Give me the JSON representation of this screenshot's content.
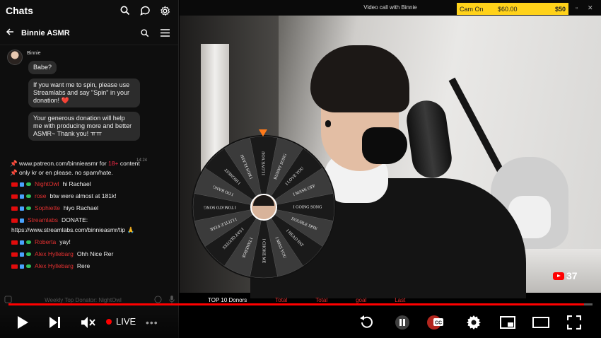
{
  "chats": {
    "title": "Chats",
    "icons": [
      "search-icon",
      "new-chat-icon",
      "settings-icon"
    ]
  },
  "conversation": {
    "name": "Binnie ASMR",
    "sender": "Binnie",
    "messages": [
      "Babe?",
      "If you want me to spin, please use Streamlabs and say \"Spin\" in your donation! ❤️",
      "Your generous donation will help me with producing more and better ASMR~ Thank you! ㅠㅠ"
    ],
    "timestamp": "14:24"
  },
  "live_chat": {
    "pinned_prefix": "📌 www.patreon.com/binnieasmr for ",
    "pinned_highlight": "18+",
    "pinned_suffix": " content",
    "pinned_line2": "📌 only kr or en please. no spam/hate.",
    "lines": [
      {
        "user": "NightOwl",
        "text": "hi Rachael"
      },
      {
        "user": "rose",
        "text": "btw were almost at 181k!"
      },
      {
        "user": "Sophiette",
        "text": "hiyo Rachael"
      },
      {
        "user": "Streamlabs",
        "text": "DONATE:"
      }
    ],
    "url_line": "https://www.streamlabs.com/binnieasmr/tip 🙏",
    "lines2": [
      {
        "user": "Roberta",
        "text": "yay!"
      },
      {
        "user": "Alex Hyllebarg",
        "text": "Ohh Nice Rer"
      },
      {
        "user": "Alex Hyllebarg",
        "text": "Rere"
      }
    ],
    "input_placeholder": "Weekly Top Donator: NightOwl"
  },
  "video": {
    "call_title": "Video call with Binnie",
    "cam_label": "Cam On",
    "cam_price": "$60.00",
    "cam_tip": "$50",
    "viewer_count": "37",
    "ticker": [
      "TOP 10 Donors",
      "Total",
      "Total",
      "goal",
      "Last"
    ],
    "wheel": {
      "segments": [
        "I LOVE YOU",
        "BUNNY SONG",
        "I LOVE YOU",
        "I MASK OFF",
        "I GOING SONG",
        "DOUBLE SPIN",
        "I HEAD PAT",
        "I MISS YOU",
        "I CHOKE ME",
        "I TAKEBOE",
        "I SAY QUOTES",
        "I LITTLE STAR",
        "I TOMATO SONG",
        "I DO BANG",
        "I HIGHEST",
        "I RUN FLASH"
      ],
      "colors": [
        "#1a1a1a",
        "#3b3b3b"
      ]
    }
  },
  "player": {
    "live_label": "LIVE",
    "progress_fraction": 0.985,
    "accent": "#ff0000"
  }
}
